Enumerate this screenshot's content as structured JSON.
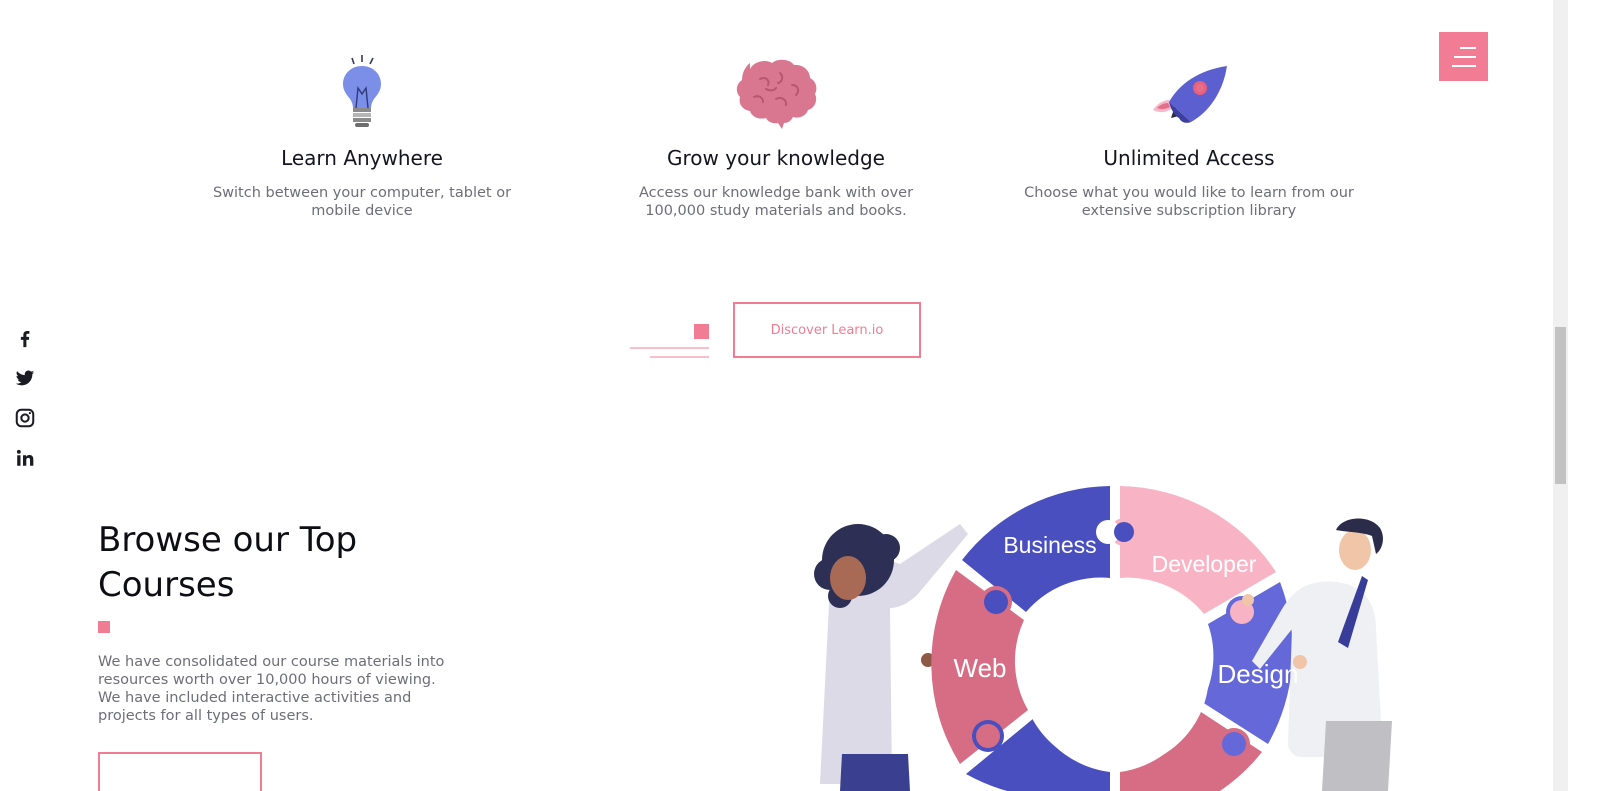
{
  "features": [
    {
      "title": "Learn Anywhere",
      "description": "Switch between your computer, tablet or mobile device",
      "icon": "lightbulb-icon"
    },
    {
      "title": "Grow your knowledge",
      "description": "Access our knowledge bank with over 100,000 study materials and books.",
      "icon": "brain-icon"
    },
    {
      "title": "Unlimited Access",
      "description": "Choose what you would like to learn from our extensive subscription library",
      "icon": "rocket-icon"
    }
  ],
  "discover_button": {
    "label": "Discover Learn.io"
  },
  "social": [
    "facebook-icon",
    "twitter-icon",
    "instagram-icon",
    "linkedin-icon"
  ],
  "courses": {
    "title": "Browse our Top Courses",
    "description": "We have consolidated our course materials into resources worth over 10,000 hours of viewing. We have included interactive activities and projects for all types of users."
  },
  "puzzle": {
    "pieces": [
      "Business",
      "Developer",
      "Web",
      "Design"
    ]
  },
  "colors": {
    "accent": "#f27c93",
    "indigo": "#4a4fbf",
    "pink_light": "#f8b3c4",
    "rose": "#d76d84",
    "periwinkle": "#6468d8"
  }
}
